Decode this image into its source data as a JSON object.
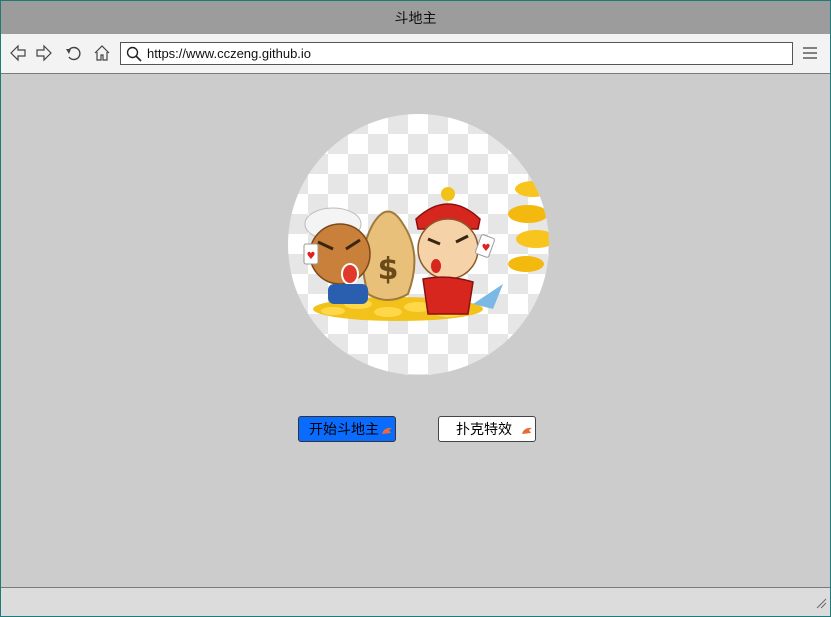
{
  "window": {
    "title": "斗地主"
  },
  "toolbar": {
    "url": "https://www.cczeng.github.io",
    "icons": [
      "back-arrow-icon",
      "forward-arrow-icon",
      "reload-icon",
      "home-icon",
      "search-icon",
      "menu-icon"
    ]
  },
  "main": {
    "hero_image": "dou-di-zhu-characters-illustration",
    "buttons": {
      "start_label": "开始斗地主",
      "poker_label": "扑克特效"
    }
  },
  "colors": {
    "titlebar": "#9c9c9c",
    "content_bg": "#cccccc",
    "start_button": "#0a6cff",
    "window_border": "#1f7a7a"
  }
}
